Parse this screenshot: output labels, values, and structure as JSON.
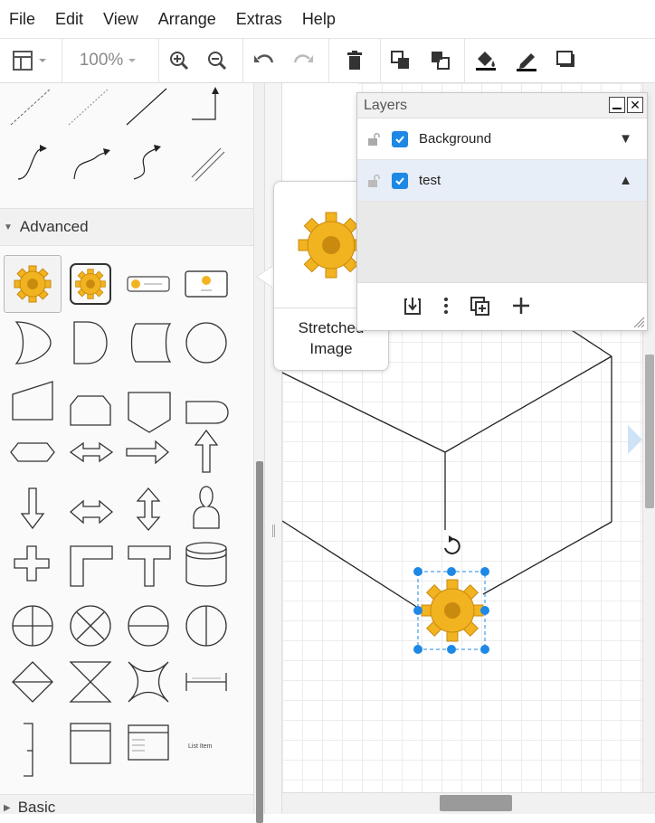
{
  "menu": [
    "File",
    "Edit",
    "View",
    "Arrange",
    "Extras",
    "Help"
  ],
  "toolbar": {
    "zoom": "100%"
  },
  "sidebar": {
    "advanced_label": "Advanced",
    "basic_label": "Basic",
    "shape_labels": {
      "list_item": "List Item"
    }
  },
  "tooltip": {
    "line1": "Stretched",
    "line2": "Image"
  },
  "layers": {
    "title": "Layers",
    "rows": [
      {
        "name": "Background",
        "checked": true,
        "arrow": "▼"
      },
      {
        "name": "test",
        "checked": true,
        "arrow": "▲"
      }
    ]
  },
  "colors": {
    "accent": "#1e88e5",
    "gear": "#f2b320",
    "handle": "#1e88e5"
  }
}
